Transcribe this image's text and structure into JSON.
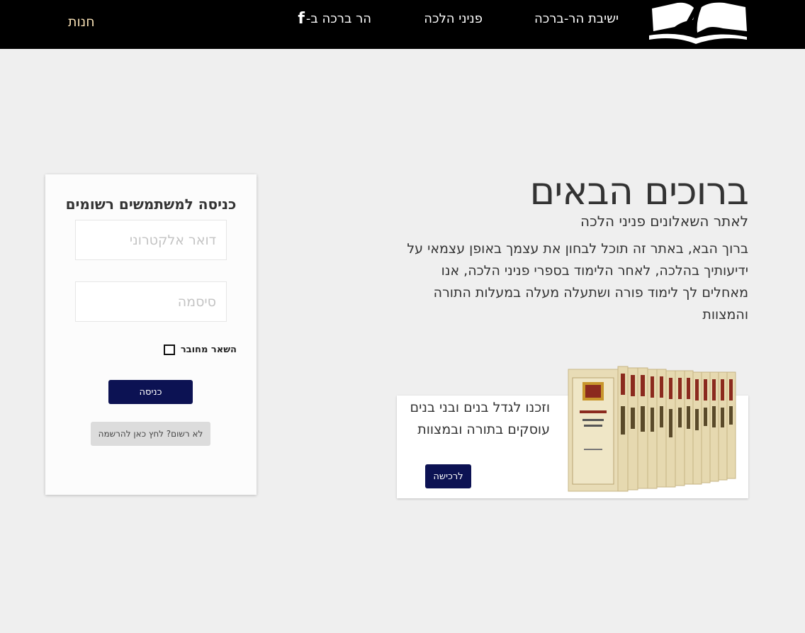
{
  "nav": {
    "yeshiva": "ישיבת הר-ברכה",
    "pninei": "פניני הלכה",
    "facebook_text": "הר ברכה ב-",
    "facebook_icon": "facebook-icon",
    "store": "חנות"
  },
  "hero": {
    "title": "ברוכים הבאים",
    "subtitle": "לאתר השאלונים פניני הלכה",
    "body": "ברוך הבא, באתר זה תוכל לבחון את עצמך באופן עצמאי על ידיעותיך בהלכה, לאחר הלימוד בספרי פניני הלכה, אנו מאחלים לך לימוד פורה ושתעלה מעלה במעלות התורה והמצוות"
  },
  "promo": {
    "text": "וזכנו לגדל בנים ובני בנים עוסקים בתורה ובמצוות",
    "button": "לרכישה"
  },
  "login": {
    "title": "כניסה למשתמשים רשומים",
    "email_placeholder": "דואר אלקטרוני",
    "password_placeholder": "סיסמה",
    "remember": "השאר מחובר",
    "submit": "כניסה",
    "register": "לא רשום? לחץ כאן להרשמה"
  },
  "colors": {
    "topbar": "#000000",
    "primary_button": "#0c1253",
    "store_link": "#f5deb3",
    "background": "#efefef"
  }
}
